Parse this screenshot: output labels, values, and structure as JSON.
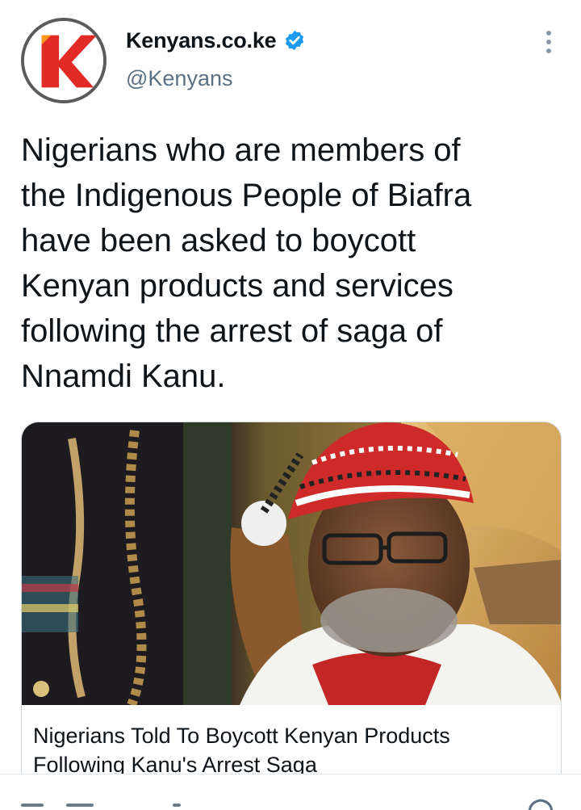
{
  "account": {
    "display_name": "Kenyans.co.ke",
    "handle": "@Kenyans",
    "verified": true,
    "avatar_icon": "kenyans-k-logo-icon",
    "brand_color": "#e22b26"
  },
  "tweet": {
    "text": "Nigerians who are members of\nthe Indigenous People of Biafra\nhave been asked to boycott\nKenyan products and services\nfollowing the arrest of saga of\nNnamdi Kanu."
  },
  "card": {
    "title": "Nigerians Told To Boycott Kenyan Products\nFollowing Kanu's Arrest Saga",
    "image_icon": "article-photo"
  },
  "icons": {
    "more": "more-options-icon",
    "verified": "verified-badge-icon",
    "share": "share-icon"
  },
  "colors": {
    "text_primary": "#0f1419",
    "text_secondary": "#5b7083",
    "verified_blue": "#1d9bf0",
    "border": "#cfd9de"
  }
}
